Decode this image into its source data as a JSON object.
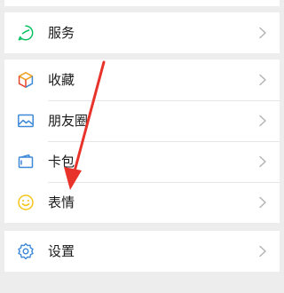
{
  "menu": {
    "group1": [
      {
        "label": "服务",
        "icon": "chat-check-icon",
        "color": "#07c160"
      }
    ],
    "group2": [
      {
        "label": "收藏",
        "icon": "cube-icon",
        "color": "#f0a020"
      },
      {
        "label": "朋友圈",
        "icon": "image-icon",
        "color": "#3d88d8"
      },
      {
        "label": "卡包",
        "icon": "wallet-icon",
        "color": "#3d88d8"
      },
      {
        "label": "表情",
        "icon": "smiley-icon",
        "color": "#f5c518"
      }
    ],
    "group3": [
      {
        "label": "设置",
        "icon": "gear-icon",
        "color": "#3d88d8"
      }
    ]
  },
  "colors": {
    "background": "#ededed",
    "annotation_arrow": "#e8332b"
  }
}
